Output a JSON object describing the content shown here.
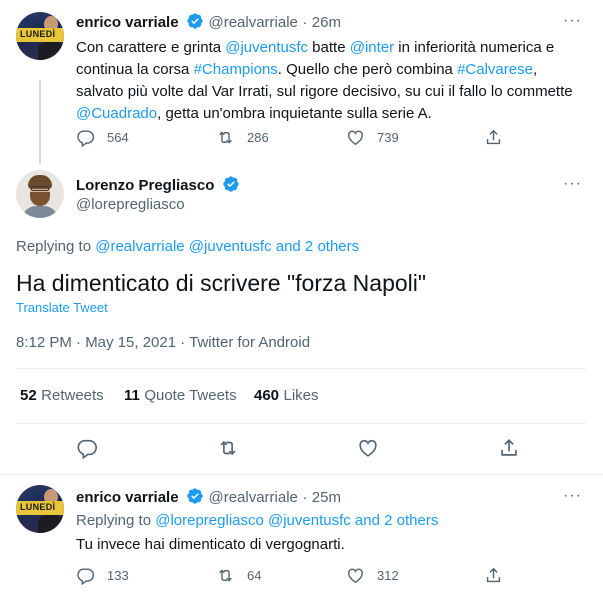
{
  "tweet1": {
    "author_name": "enrico varriale",
    "handle": "@realvarriale",
    "separator": "·",
    "time": "26m",
    "avatar_text": "LUNEDÌ",
    "text": {
      "p1": "Con carattere e grinta ",
      "m1": "@juventusfc",
      "p2": " batte ",
      "m2": "@inter",
      "p3": " in inferiorità numerica e continua la corsa  ",
      "m3": "#Champions",
      "p4": ". Quello che però  combina ",
      "m4": "#Calvarese",
      "p5": ", salvato più  volte dal Var Irrati, sul rigore decisivo, su cui il fallo lo commette ",
      "m5": "@Cuadrado",
      "p6": ", getta un'ombra inquietante sulla serie A."
    },
    "replies": "564",
    "retweets": "286",
    "likes": "739"
  },
  "main_tweet": {
    "author_name": "Lorenzo Pregliasco",
    "handle": "@lorepregliasco",
    "replying_prefix": "Replying to ",
    "replying_to": "@realvarriale @juventusfc and 2 others",
    "text": "Ha dimenticato di scrivere \"forza Napoli\"",
    "translate": "Translate Tweet",
    "timestamp": "8:12 PM · May 15, 2021 · Twitter for Android",
    "retweets_count": "52",
    "retweets_label": "Retweets",
    "quotes_count": "11",
    "quotes_label": "Quote Tweets",
    "likes_count": "460",
    "likes_label": "Likes"
  },
  "tweet3": {
    "author_name": "enrico varriale",
    "handle": "@realvarriale",
    "separator": "·",
    "time": "25m",
    "avatar_text": "LUNEDÌ",
    "replying_prefix": "Replying to ",
    "replying_to": "@lorepregliasco @juventusfc and 2 others",
    "text": "Tu invece hai dimenticato di vergognarti.",
    "replies": "133",
    "retweets": "64",
    "likes": "312"
  },
  "icons": {
    "more": "···",
    "verified": "verified-badge-icon",
    "reply": "reply-icon",
    "retweet": "retweet-icon",
    "like": "heart-icon",
    "share": "share-icon"
  },
  "colors": {
    "accent": "#1d9bf0",
    "muted": "#536471",
    "divider": "#eff3f4"
  }
}
